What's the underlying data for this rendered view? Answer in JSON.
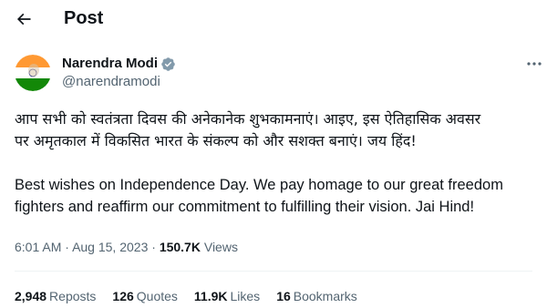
{
  "header": {
    "back_icon": "arrow-left-icon",
    "title": "Post"
  },
  "author": {
    "display_name": "Narendra Modi",
    "handle": "@narendramodi",
    "verified_icon": "verified-badge-icon",
    "verified_color": "#829aab",
    "avatar_colors": [
      "#ff9933",
      "#ffffff",
      "#138808"
    ]
  },
  "more_icon": "more-horizontal-icon",
  "tweet": {
    "hindi_line_1": "आप सभी को स्वतंत्रता दिवस की अनेकानेक शुभकामनाएं। आइए, इस ऐतिहासिक अवसर",
    "hindi_line_2": "पर अमृतकाल में विकसित भारत के संकल्प को और सशक्त बनाएं। जय हिंद!",
    "english_line_1": "Best wishes on Independence Day. We pay homage to our great freedom",
    "english_line_2": "fighters and reaffirm our commitment to fulfilling their vision. Jai Hind!"
  },
  "meta": {
    "time": "6:01 AM",
    "separator": "·",
    "date": "Aug 15, 2023",
    "views_count": "150.7K",
    "views_label": "Views"
  },
  "stats": {
    "reposts_count": "2,948",
    "reposts_label": "Reposts",
    "quotes_count": "126",
    "quotes_label": "Quotes",
    "likes_count": "11.9K",
    "likes_label": "Likes",
    "bookmarks_count": "16",
    "bookmarks_label": "Bookmarks"
  }
}
